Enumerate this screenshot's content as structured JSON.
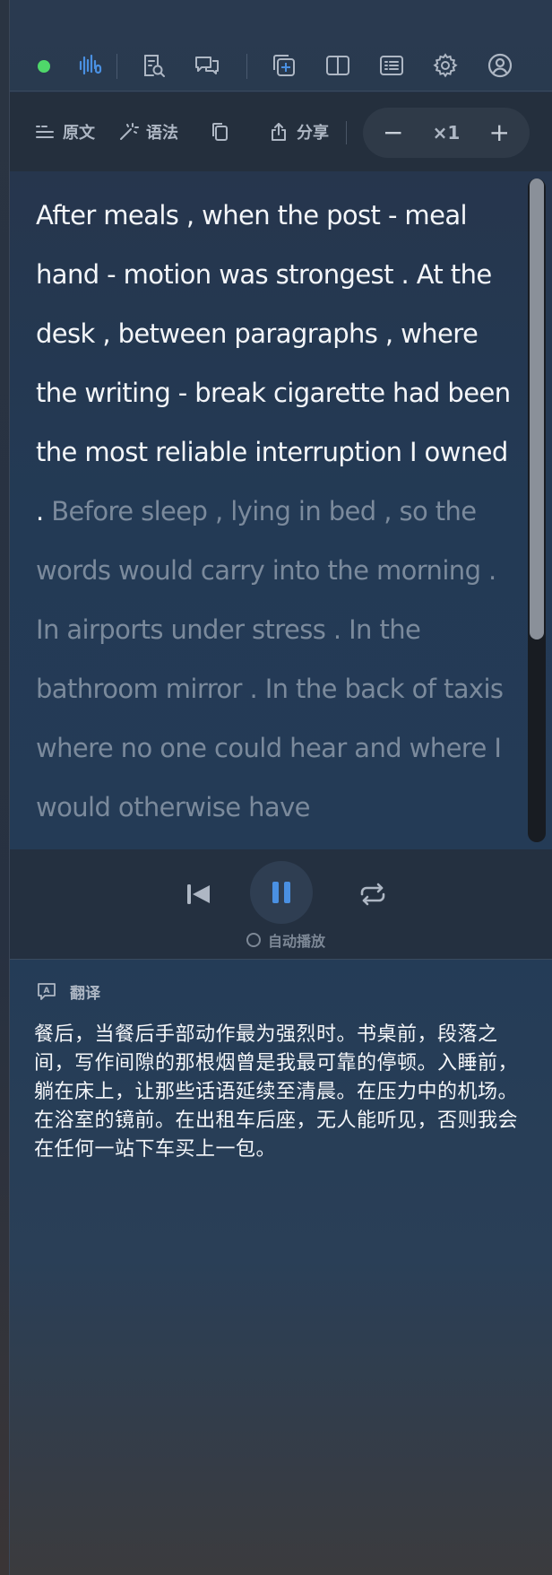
{
  "toolbar": {
    "icons": [
      "status-dot",
      "voice-wave-icon",
      "search-doc-icon",
      "chat-bubbles-icon",
      "add-window-icon",
      "split-view-icon",
      "list-view-icon",
      "gear-icon",
      "account-icon"
    ]
  },
  "subbar": {
    "original_label": "原文",
    "grammar_label": "语法",
    "share_label": "分享",
    "speed_minus": "−",
    "speed_value": "×1",
    "speed_plus": "+"
  },
  "reader": {
    "read_text": "After meals , when the post - meal hand - motion was strongest . At the desk , between paragraphs , where the writing - break cigarette had been the most reliable interruption I owned . ",
    "unread_text": "Before sleep , lying in bed , so the words would carry into the morning . In airports under stress . In the bathroom mirror . In the back of taxis where no one could hear and where I would otherwise have"
  },
  "player": {
    "autoplay_label": "自动播放"
  },
  "translation": {
    "title": "翻译",
    "text": "餐后，当餐后手部动作最为强烈时。书桌前，段落之间，写作间隙的那根烟曾是我最可靠的停顿。入睡前，躺在床上，让那些话语延续至清晨。在压力中的机场。在浴室的镜前。在出租车后座，无人能听见，否则我会在任何一站下车买上一包。"
  },
  "colors": {
    "accent": "#4a90e2",
    "status_green": "#4fd76a",
    "text_primary": "#f4f6f9",
    "text_dim": "#7b8a9c"
  }
}
